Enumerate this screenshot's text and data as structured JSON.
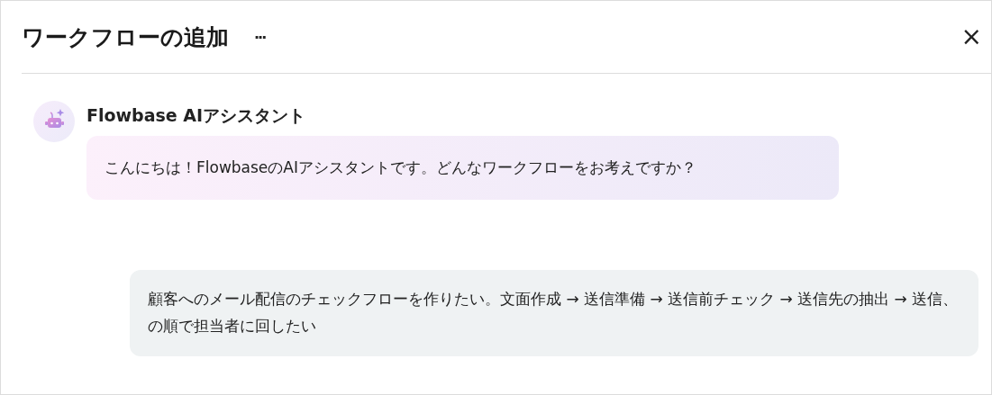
{
  "window": {
    "title": "ワークフローの追加",
    "more": "···",
    "close": "×"
  },
  "messages": [
    {
      "kind": "assistant",
      "sender": "Flowbase AIアシスタント",
      "text": "こんにちは！FlowbaseのAIアシスタントです。どんなワークフローをお考えですか？"
    },
    {
      "kind": "user",
      "text": "顧客へのメール配信のチェックフローを作りたい。文面作成 → 送信準備 → 送信前チェック → 送信先の抽出 → 送信、の順で担当者に回したい"
    }
  ]
}
